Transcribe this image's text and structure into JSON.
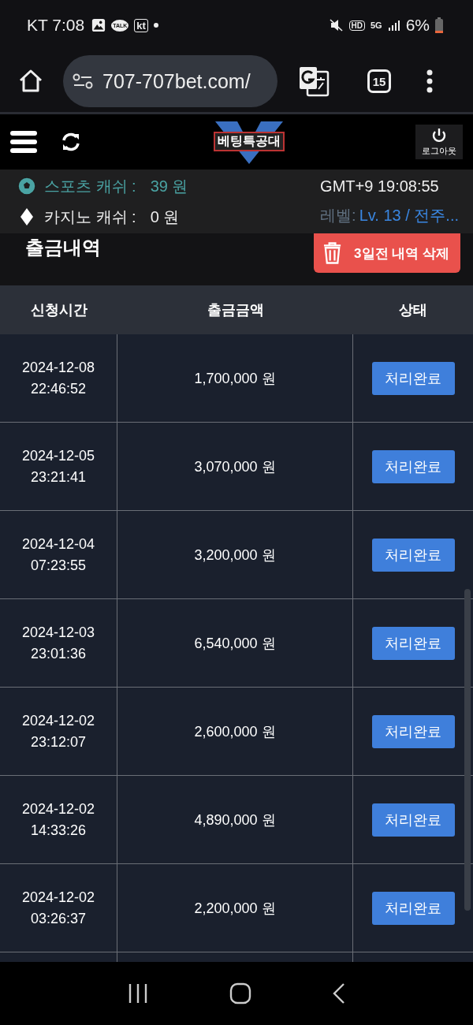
{
  "status_bar": {
    "carrier_time": "KT 7:08",
    "badges": [
      "TALK",
      "kt"
    ],
    "network_badges": [
      "HD",
      "5G"
    ],
    "battery": "6%"
  },
  "browser": {
    "url": "707-707bet.com/",
    "tab_count": "15"
  },
  "site_header": {
    "logo": "베팅특공대",
    "logout": "로그아웃"
  },
  "info_bar": {
    "sports_label": "스포츠 캐쉬 :",
    "sports_value": "39 원",
    "casino_label": "카지노 캐쉬 :",
    "casino_value": "0 원",
    "clock": "GMT+9 19:08:55",
    "level_label": "레벨:",
    "level_value": "Lv. 13 / 전주..."
  },
  "page": {
    "title": "출금내역",
    "delete_button": "3일전 내역 삭제"
  },
  "table": {
    "columns": [
      "신청시간",
      "출금금액",
      "상태"
    ],
    "rows": [
      {
        "date": "2024-12-08",
        "time": "22:46:52",
        "amount": "1,700,000 원",
        "status": "처리완료"
      },
      {
        "date": "2024-12-05",
        "time": "23:21:41",
        "amount": "3,070,000 원",
        "status": "처리완료"
      },
      {
        "date": "2024-12-04",
        "time": "07:23:55",
        "amount": "3,200,000 원",
        "status": "처리완료"
      },
      {
        "date": "2024-12-03",
        "time": "23:01:36",
        "amount": "6,540,000 원",
        "status": "처리완료"
      },
      {
        "date": "2024-12-02",
        "time": "23:12:07",
        "amount": "2,600,000 원",
        "status": "처리완료"
      },
      {
        "date": "2024-12-02",
        "time": "14:33:26",
        "amount": "4,890,000 원",
        "status": "처리완료"
      },
      {
        "date": "2024-12-02",
        "time": "03:26:37",
        "amount": "2,200,000 원",
        "status": "처리완료"
      }
    ]
  }
}
